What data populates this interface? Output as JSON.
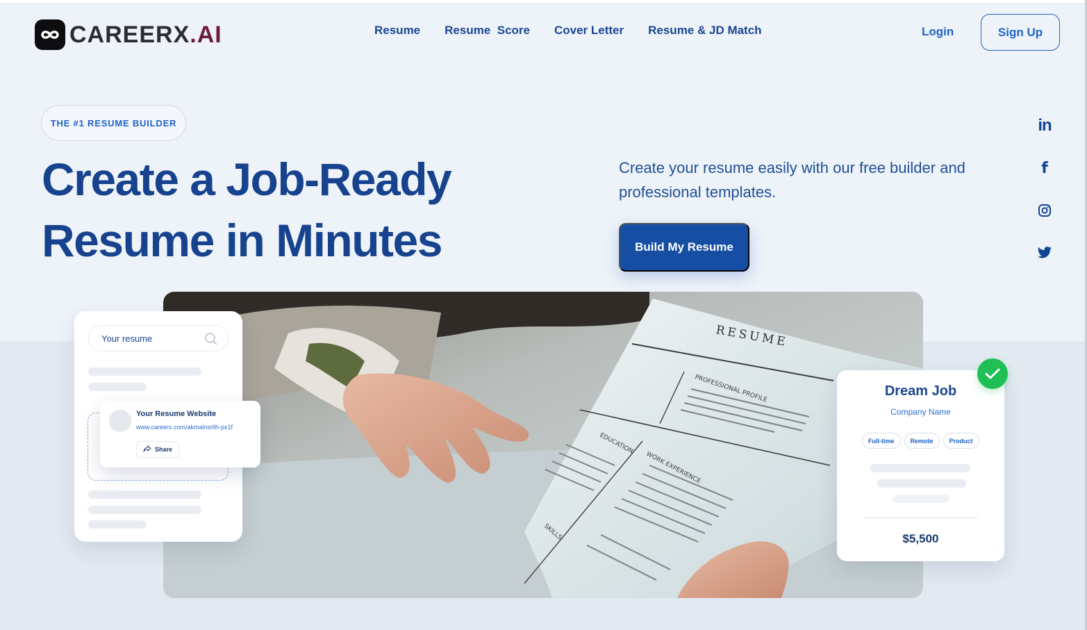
{
  "brand": {
    "name_main": "CAREERX",
    "name_suffix": ".AI",
    "logo_icon": "infinity-icon"
  },
  "nav": {
    "items": [
      {
        "label": "Resume"
      },
      {
        "label": "Resume  Score"
      },
      {
        "label": "Cover Letter"
      },
      {
        "label": "Resume & JD Match"
      }
    ],
    "login_label": "Login",
    "signup_label": "Sign Up"
  },
  "hero": {
    "badge": "THE #1 RESUME BUILDER",
    "headline_line1": "Create a Job-Ready",
    "headline_line2": "Resume in Minutes",
    "subtext": "Create your resume easily with our free builder and professional templates.",
    "cta_label": "Build My Resume"
  },
  "socials": [
    {
      "icon": "linkedin-icon"
    },
    {
      "icon": "facebook-icon"
    },
    {
      "icon": "instagram-icon"
    },
    {
      "icon": "twitter-icon"
    }
  ],
  "photo": {
    "resume_heading": "RESUME",
    "sections": [
      "PROFESSIONAL PROFILE",
      "EDUCATION",
      "WORK EXPERIENCE",
      "SKILLS"
    ]
  },
  "resume_card": {
    "search_placeholder": "Your resume",
    "website_title": "Your Resume Website",
    "website_url": "www.careerx.com/akmalnsrllh-px1f",
    "share_label": "Share"
  },
  "job_card": {
    "title": "Dream Job",
    "company": "Company Name",
    "tags": [
      "Full-time",
      "Remote",
      "Product"
    ],
    "salary": "$5,500"
  },
  "colors": {
    "primary": "#17438e",
    "accent": "#1f63c6",
    "cta": "#154ea3",
    "success": "#1fbf56",
    "page_bg": "#eef3fa"
  }
}
